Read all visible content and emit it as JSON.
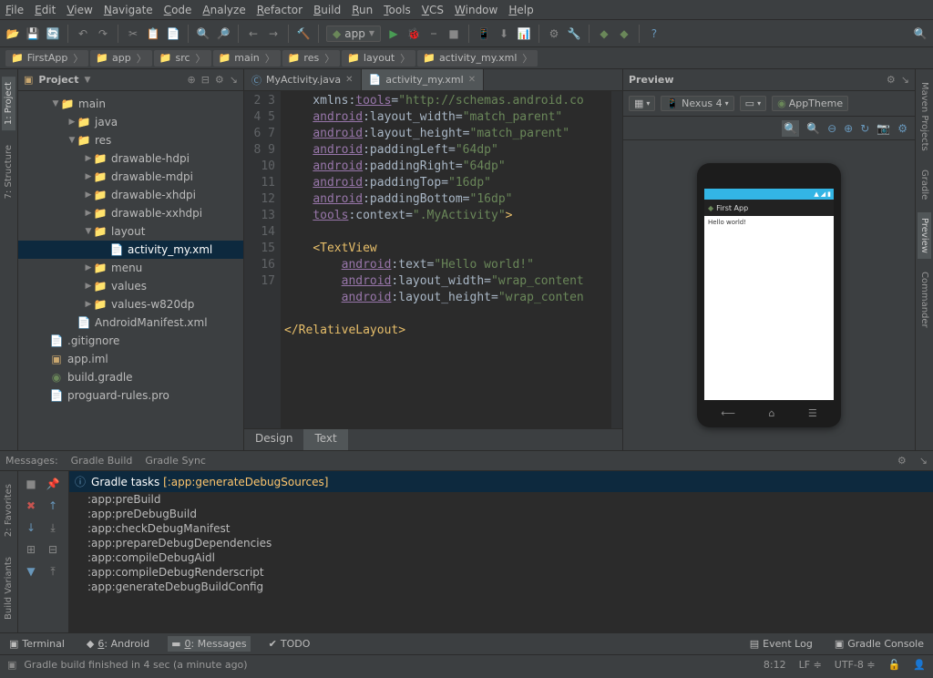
{
  "menu": [
    "File",
    "Edit",
    "View",
    "Navigate",
    "Code",
    "Analyze",
    "Refactor",
    "Build",
    "Run",
    "Tools",
    "VCS",
    "Window",
    "Help"
  ],
  "run_config": "app",
  "breadcrumbs": [
    "FirstApp",
    "app",
    "src",
    "main",
    "res",
    "layout",
    "activity_my.xml"
  ],
  "project": {
    "title": "Project",
    "tree": [
      {
        "indent": 0,
        "arrow": "▼",
        "icon": "folder",
        "label": "main"
      },
      {
        "indent": 1,
        "arrow": "▶",
        "icon": "folder",
        "label": "java"
      },
      {
        "indent": 1,
        "arrow": "▼",
        "icon": "folder",
        "label": "res"
      },
      {
        "indent": 2,
        "arrow": "▶",
        "icon": "folder",
        "label": "drawable-hdpi"
      },
      {
        "indent": 2,
        "arrow": "▶",
        "icon": "folder",
        "label": "drawable-mdpi"
      },
      {
        "indent": 2,
        "arrow": "▶",
        "icon": "folder",
        "label": "drawable-xhdpi"
      },
      {
        "indent": 2,
        "arrow": "▶",
        "icon": "folder",
        "label": "drawable-xxhdpi"
      },
      {
        "indent": 2,
        "arrow": "▼",
        "icon": "folder",
        "label": "layout"
      },
      {
        "indent": 3,
        "arrow": "",
        "icon": "xml",
        "label": "activity_my.xml",
        "selected": true
      },
      {
        "indent": 2,
        "arrow": "▶",
        "icon": "folder",
        "label": "menu"
      },
      {
        "indent": 2,
        "arrow": "▶",
        "icon": "folder",
        "label": "values"
      },
      {
        "indent": 2,
        "arrow": "▶",
        "icon": "folder",
        "label": "values-w820dp"
      },
      {
        "indent": 1,
        "arrow": "",
        "icon": "xml",
        "label": "AndroidManifest.xml"
      },
      {
        "indent": 0,
        "arrow": "",
        "icon": "file",
        "label": ".gitignore",
        "noindent": true
      },
      {
        "indent": 0,
        "arrow": "",
        "icon": "iml",
        "label": "app.iml",
        "noindent": true
      },
      {
        "indent": 0,
        "arrow": "",
        "icon": "gradle",
        "label": "build.gradle",
        "noindent": true
      },
      {
        "indent": 0,
        "arrow": "",
        "icon": "file",
        "label": "proguard-rules.pro",
        "noindent": true
      }
    ]
  },
  "left_tabs": [
    "1: Project",
    "7: Structure"
  ],
  "left_tabs2": [
    "2: Favorites",
    "Build Variants"
  ],
  "right_tabs": [
    "Maven Projects",
    "Gradle",
    "Preview",
    "Commander"
  ],
  "editor": {
    "tabs": [
      {
        "label": "MyActivity.java",
        "icon": "c",
        "active": false
      },
      {
        "label": "activity_my.xml",
        "icon": "xml",
        "active": true
      }
    ],
    "gutter_start": 2,
    "gutter_end": 17,
    "lines": [
      "    xmlns:<ns>tools</ns>=<str>\"http://schemas.android.co</str>",
      "    <ns>android</ns>:layout_width=<str>\"match_parent\"</str>",
      "    <ns>android</ns>:layout_height=<str>\"match_parent\"</str>",
      "    <ns>android</ns>:paddingLeft=<str>\"64dp\"</str>",
      "    <ns>android</ns>:paddingRight=<str>\"64dp\"</str>",
      "    <ns>android</ns>:paddingTop=<str>\"16dp\"</str>",
      "    <ns>android</ns>:paddingBottom=<str>\"16dp\"</str>",
      "    <ns>tools</ns>:context=<str>\".MyActivity\"</str><tag>&gt;</tag>",
      "",
      "    <tag>&lt;TextView</tag>",
      "        <ns>android</ns>:text=<str>\"Hello world!\"</str>",
      "        <ns>android</ns>:layout_width=<str>\"wrap_content</str>",
      "        <ns>android</ns>:layout_height=<str>\"wrap_conten</str>",
      "",
      "<tag>&lt;/RelativeLayout&gt;</tag>",
      ""
    ],
    "design_tabs": [
      "Design",
      "Text"
    ],
    "design_active": 1
  },
  "preview": {
    "title": "Preview",
    "device": "Nexus 4",
    "theme": "AppTheme",
    "app_title": "First App",
    "content": "Hello world!"
  },
  "messages": {
    "tabs": [
      "Messages:",
      "Gradle Build",
      "Gradle Sync"
    ],
    "header_prefix": "Gradle tasks ",
    "header_task": "[:app:generateDebugSources]",
    "lines": [
      ":app:preBuild",
      ":app:preDebugBuild",
      ":app:checkDebugManifest",
      ":app:prepareDebugDependencies",
      ":app:compileDebugAidl",
      ":app:compileDebugRenderscript",
      ":app:generateDebugBuildConfig"
    ]
  },
  "bottom_tools": {
    "left": [
      {
        "label": "Terminal",
        "icon": "▣"
      },
      {
        "label": "6: Android",
        "icon": "◆",
        "underline": "6"
      },
      {
        "label": "0: Messages",
        "icon": "▬",
        "underline": "0",
        "active": true
      },
      {
        "label": "TODO",
        "icon": "✔"
      }
    ],
    "right": [
      {
        "label": "Event Log",
        "icon": "▤"
      },
      {
        "label": "Gradle Console",
        "icon": "▣"
      }
    ]
  },
  "status": {
    "text": "Gradle build finished in 4 sec (a minute ago)",
    "pos": "8:12",
    "line_ending": "LF",
    "encoding": "UTF-8",
    "lock": "🔒"
  }
}
